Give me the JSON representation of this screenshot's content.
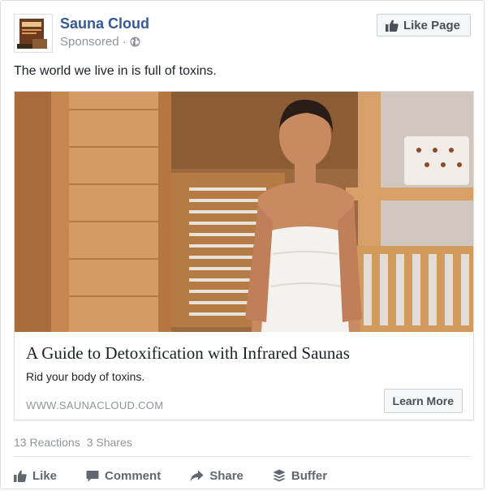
{
  "post": {
    "page_name": "Sauna Cloud",
    "sponsored_label": "Sponsored",
    "like_page_label": "Like Page",
    "text": "The world we live in is full of toxins."
  },
  "link_card": {
    "title": "A Guide to Detoxification with Infrared Saunas",
    "description": "Rid your body of toxins.",
    "domain": "WWW.SAUNACLOUD.COM",
    "cta_label": "Learn More"
  },
  "engagement": {
    "reactions": "13 Reactions",
    "shares": "3 Shares"
  },
  "actions": [
    {
      "label": "Like",
      "icon": "thumbs-up-icon"
    },
    {
      "label": "Comment",
      "icon": "comment-icon"
    },
    {
      "label": "Share",
      "icon": "share-arrow-icon"
    },
    {
      "label": "Buffer",
      "icon": "buffer-stack-icon"
    }
  ],
  "colors": {
    "brand_link": "#365899",
    "muted_text": "#90949c",
    "action_text": "#616770",
    "button_bg": "#f6f7f9"
  }
}
